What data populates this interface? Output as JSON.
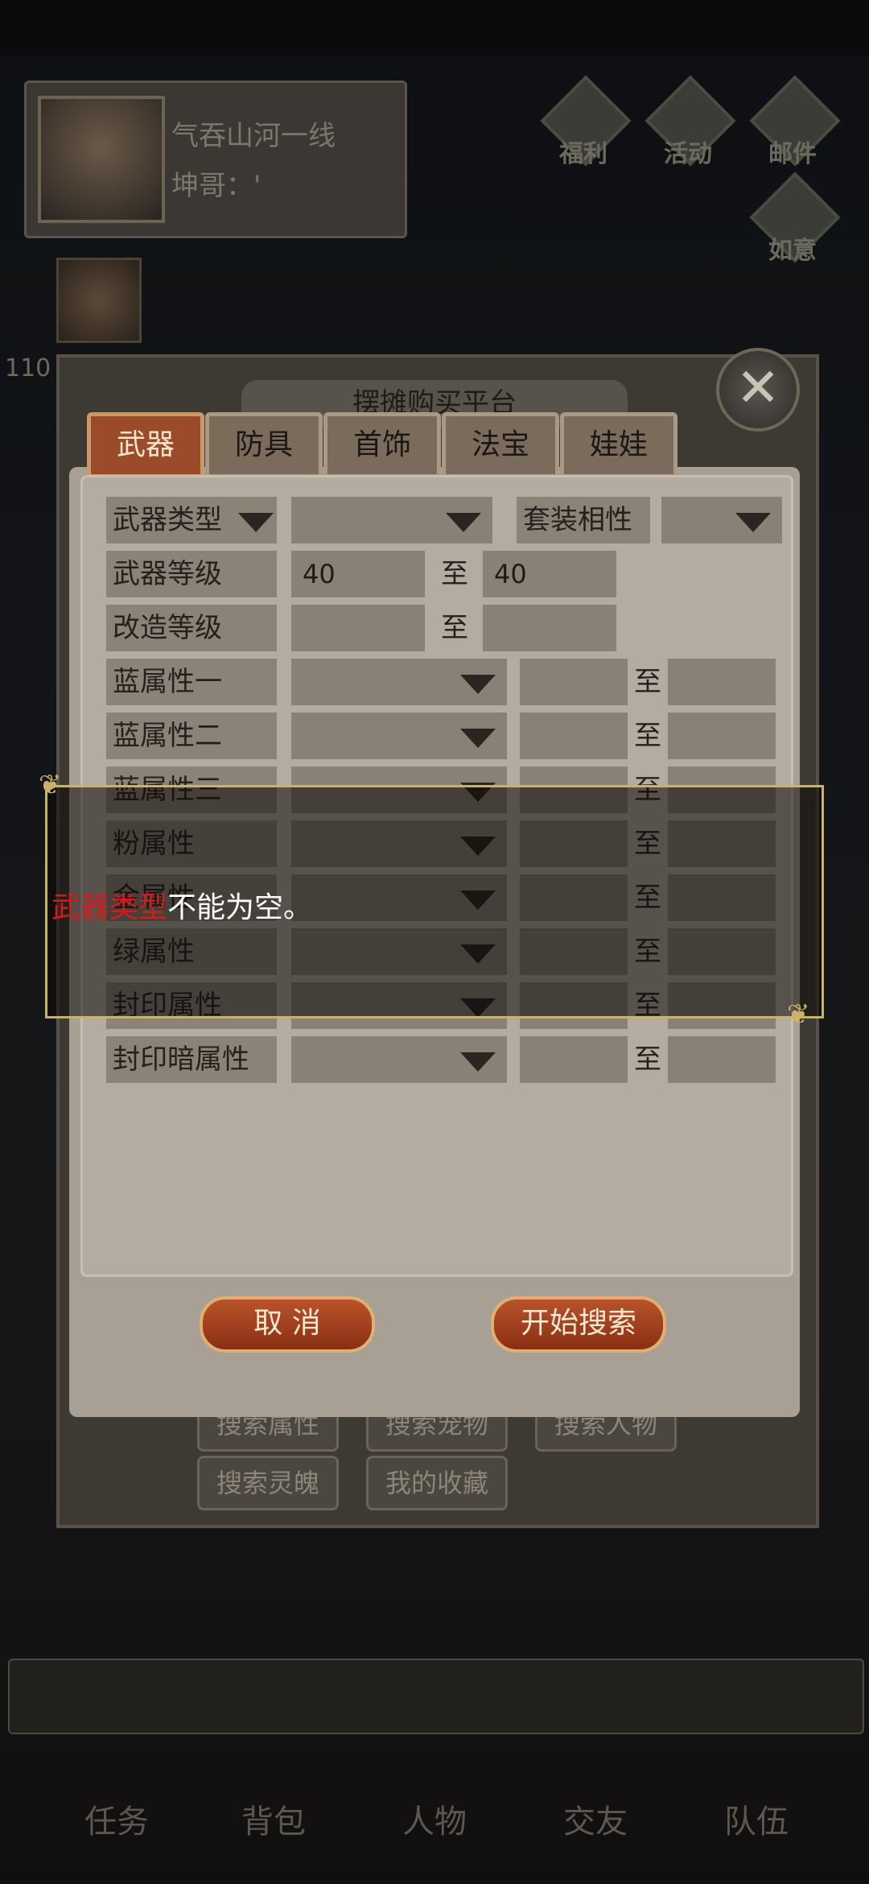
{
  "hud": {
    "player_name": "气吞山河一线",
    "player_title": "坤哥：'",
    "level": "110",
    "top_icons": [
      "福利",
      "活动",
      "邮件",
      "如意"
    ]
  },
  "market": {
    "title": "摆摊购买平台",
    "tabs": [
      "武器",
      "防具",
      "首饰",
      "法宝",
      "娃娃"
    ],
    "active_tab": "武器",
    "form": {
      "weapon_type_label": "武器类型",
      "weapon_type_value": "",
      "set_affinity_label": "套装相性",
      "set_affinity_value": "",
      "weapon_level_label": "武器等级",
      "weapon_level_min": "40",
      "weapon_level_max": "40",
      "upgrade_level_label": "改造等级",
      "upgrade_level_min": "",
      "upgrade_level_max": "",
      "to": "至",
      "attr_rows": [
        {
          "label": "蓝属性一"
        },
        {
          "label": "蓝属性二"
        },
        {
          "label": "蓝属性三"
        },
        {
          "label": "粉属性"
        },
        {
          "label": "金属性"
        },
        {
          "label": "绿属性"
        },
        {
          "label": "封印属性"
        },
        {
          "label": "封印暗属性"
        }
      ]
    },
    "cancel_button": "取 消",
    "search_button": "开始搜索",
    "bottom_buttons": [
      "搜索属性",
      "搜索宠物",
      "搜索人物",
      "搜索灵魄",
      "我的收藏"
    ]
  },
  "toast": {
    "highlight": "武器类型",
    "message": "不能为空。"
  },
  "nav": [
    "任务",
    "背包",
    "人物",
    "交友",
    "队伍"
  ]
}
